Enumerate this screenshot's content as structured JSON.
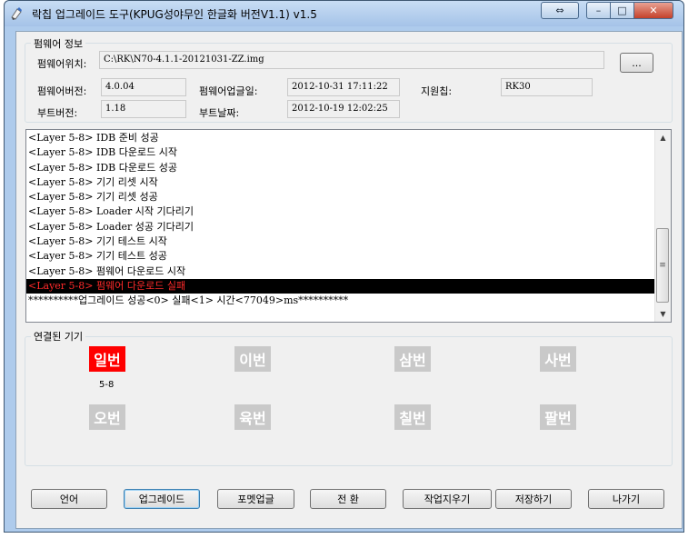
{
  "window": {
    "title": "락칩 업그레이드 도구(KPUG성야무인 한글화 버전V1.1) v1.5",
    "restore_glyph": "⇔",
    "minimize_glyph": "–",
    "maximize_glyph": "□",
    "close_glyph": "✕"
  },
  "firmware_info": {
    "group_label": "펌웨어 정보",
    "path_label": "펌웨어위치:",
    "path_value": "C:\\RK\\N70-4.1.1-20121031-ZZ.img",
    "browse_label": "...",
    "version_label": "펌웨어버전:",
    "version_value": "4.0.04",
    "upload_label": "펌웨어업글일:",
    "upload_value": "2012-10-31  17:11:22",
    "chip_label": "지원칩:",
    "chip_value": "RK30",
    "boot_version_label": "부트버전:",
    "boot_version_value": "1.18",
    "boot_date_label": "부트날짜:",
    "boot_date_value": "2012-10-19  12:02:25"
  },
  "log": {
    "lines": [
      "<Layer 5-8> IDB 준비 성공",
      "<Layer 5-8> IDB 다운로드 시작",
      "<Layer 5-8> IDB 다운로드 성공",
      "<Layer 5-8> 기기 리셋 시작",
      "<Layer 5-8> 기기 리셋 성공",
      "<Layer 5-8> Loader 시작 기다리기",
      "<Layer 5-8> Loader 성공 기다리기",
      "<Layer 5-8> 기기 테스트 시작",
      "<Layer 5-8> 기기 테스트 성공",
      "<Layer 5-8> 펌웨어 다운로드 시작",
      "<Layer 5-8> 펌웨어 다운로드 실패",
      "**********업그레이드 성공<0> 실패<1> 시간<77049>ms**********"
    ],
    "selected_index": 10,
    "scroll_up_glyph": "▲",
    "scroll_down_glyph": "▼",
    "thumb_grip": "≡"
  },
  "devices": {
    "group_label": "연결된 기기",
    "items": [
      {
        "label": "일번",
        "active": true,
        "sub": "5-8"
      },
      {
        "label": "이번",
        "active": false,
        "sub": ""
      },
      {
        "label": "삼번",
        "active": false,
        "sub": ""
      },
      {
        "label": "사번",
        "active": false,
        "sub": ""
      },
      {
        "label": "오번",
        "active": false,
        "sub": ""
      },
      {
        "label": "육번",
        "active": false,
        "sub": ""
      },
      {
        "label": "칠번",
        "active": false,
        "sub": ""
      },
      {
        "label": "팔번",
        "active": false,
        "sub": ""
      }
    ],
    "active_color": "#ff0000",
    "inactive_color": "#c9c9c9"
  },
  "buttons": {
    "language": "언어",
    "upgrade": "업그레이드",
    "format_upgrade": "포멧업글",
    "switch": "전 환",
    "clear": "작업지우기",
    "save": "저장하기",
    "exit": "나가기"
  },
  "colors": {
    "title_bar": "#aecbec",
    "dialog_bg": "#f0f0f0",
    "selected_log_text": "#ff2a2a"
  }
}
